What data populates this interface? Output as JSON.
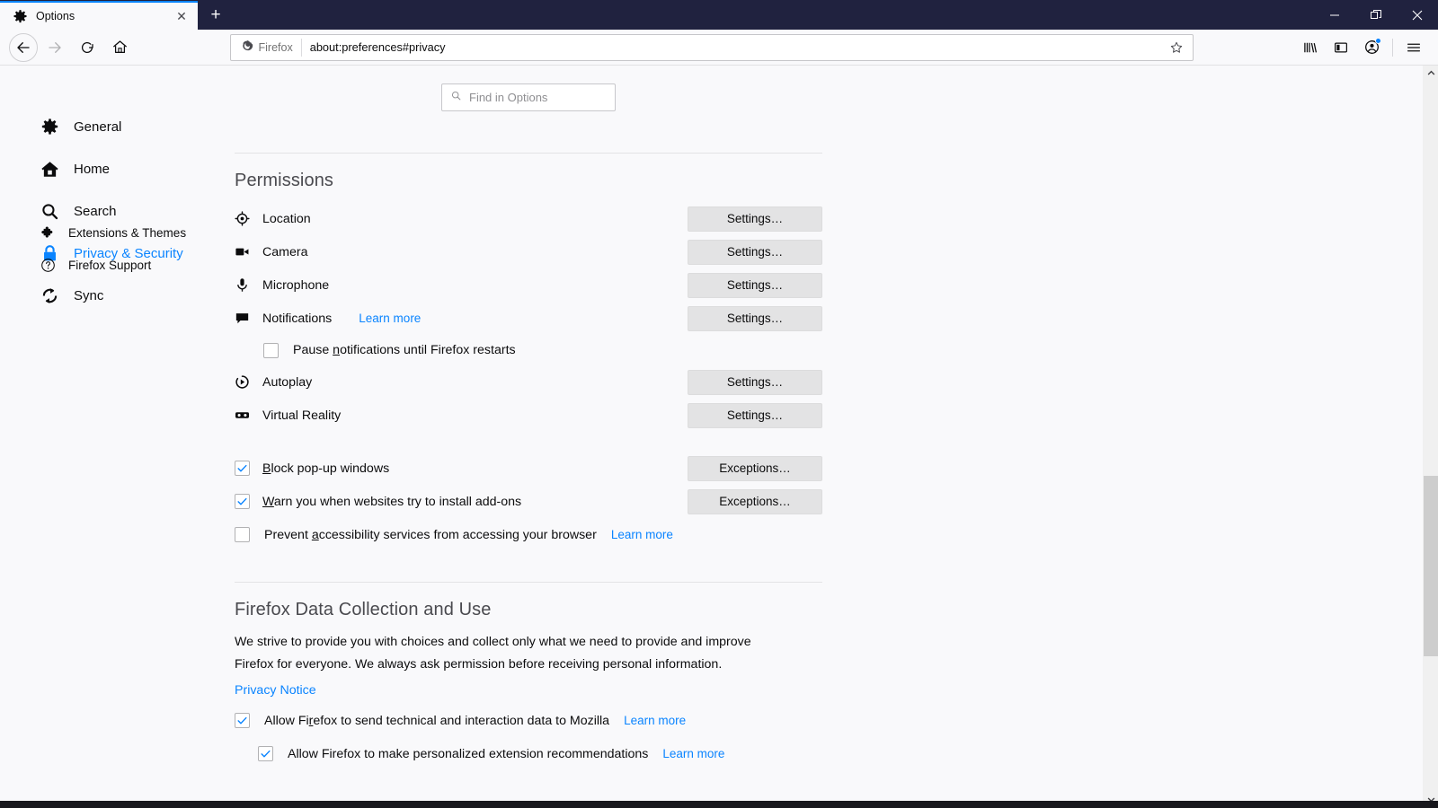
{
  "window": {
    "tab": {
      "title": "Options",
      "icon": "gear-icon",
      "close_label": "✕"
    },
    "newtab_label": "+",
    "controls": {
      "minimize": "minimize-icon",
      "restore": "restore-icon",
      "close": "close-icon"
    }
  },
  "toolbar": {
    "back": "back-icon",
    "forward": "forward-icon",
    "reload": "reload-icon",
    "home": "home-icon",
    "identity_label": "Firefox",
    "url": "about:preferences#privacy",
    "bookmark": "star-icon",
    "library": "library-icon",
    "sidebar": "sidebar-icon",
    "account": "account-icon",
    "menu": "hamburger-menu-icon"
  },
  "search": {
    "placeholder": "Find in Options",
    "icon": "search-icon"
  },
  "sidebar": {
    "items": [
      {
        "label": "General",
        "icon": "gear-icon",
        "active": false
      },
      {
        "label": "Home",
        "icon": "home-icon",
        "active": false
      },
      {
        "label": "Search",
        "icon": "search-icon",
        "active": false
      },
      {
        "label": "Privacy & Security",
        "icon": "lock-icon",
        "active": true
      },
      {
        "label": "Sync",
        "icon": "sync-icon",
        "active": false
      }
    ],
    "footer": [
      {
        "label": "Extensions & Themes",
        "icon": "puzzle-icon"
      },
      {
        "label": "Firefox Support",
        "icon": "question-icon"
      }
    ]
  },
  "permissions": {
    "title": "Permissions",
    "rows": [
      {
        "label": "Location",
        "icon": "location-icon",
        "button": "Settings…",
        "button_key": "t"
      },
      {
        "label": "Camera",
        "icon": "camera-icon",
        "button": "Settings…",
        "button_key": "t"
      },
      {
        "label": "Microphone",
        "icon": "microphone-icon",
        "button": "Settings…",
        "button_key": "t"
      },
      {
        "label": "Notifications",
        "icon": "notification-icon",
        "button": "Settings…",
        "button_key": "t",
        "learn_more": "Learn more"
      },
      {
        "label": "Autoplay",
        "icon": "autoplay-icon",
        "button": "Settings…",
        "button_key": "t"
      },
      {
        "label": "Virtual Reality",
        "icon": "vr-icon",
        "button": "Settings…",
        "button_key": "t"
      }
    ],
    "pause_notifications": {
      "label_before": "Pause ",
      "label_key": "n",
      "label_after": "otifications until Firefox restarts",
      "checked": false
    },
    "checkboxes": [
      {
        "label_before": "",
        "label_key": "B",
        "label_after": "lock pop-up windows",
        "checked": true,
        "button": "Exceptions…",
        "button_key": "E"
      },
      {
        "label_before": "",
        "label_key": "W",
        "label_after": "arn you when websites try to install add-ons",
        "checked": true,
        "button": "Exceptions…",
        "button_key": "E"
      },
      {
        "label_before": "Prevent ",
        "label_key": "a",
        "label_after": "ccessibility services from accessing your browser",
        "checked": false,
        "learn_more": "Learn more"
      }
    ]
  },
  "data_collection": {
    "title": "Firefox Data Collection and Use",
    "description": "We strive to provide you with choices and collect only what we need to provide and improve Firefox for everyone. We always ask permission before receiving personal information.",
    "privacy_notice": "Privacy Notice",
    "checkboxes": [
      {
        "label_before": "Allow Fi",
        "label_key": "r",
        "label_after": "efox to send technical and interaction data to Mozilla",
        "checked": true,
        "learn_more": "Learn more",
        "indent": false
      },
      {
        "label_before": "Allow Firefox to make personalized extension recommendations",
        "label_key": "",
        "label_after": "",
        "checked": true,
        "learn_more": "Learn more",
        "indent": true
      }
    ]
  },
  "colors": {
    "titlebar": "#20223f",
    "accent": "#0a84ff",
    "tab_highlight": "#0a84ff",
    "background": "#f9f9fb",
    "button": "#e3e3e4",
    "heading": "#4a4a4f"
  }
}
